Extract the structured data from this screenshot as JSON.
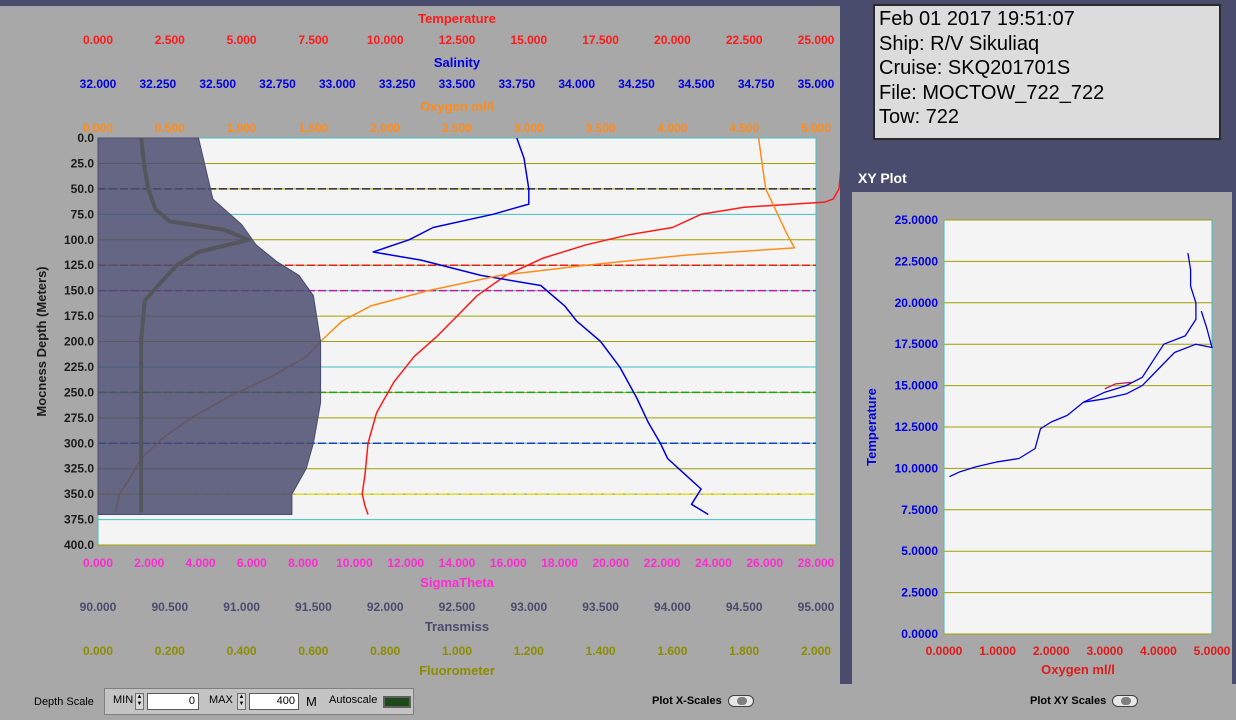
{
  "info": {
    "datetime": "Feb 01 2017 19:51:07",
    "ship": "Ship: R/V Sikuliaq",
    "cruise": "Cruise: SKQ201701S",
    "file": "File: MOCTOW_722_722",
    "tow": "Tow: 722"
  },
  "xy_panel_title": "XY Plot",
  "controls": {
    "depth_scale_label": "Depth Scale",
    "min_label": "MIN",
    "min_value": "0",
    "max_label": "MAX",
    "max_value": "400",
    "units": "M",
    "autoscale_label": "Autoscale",
    "plot_x_scales_label": "Plot X-Scales",
    "plot_xy_scales_label": "Plot XY Scales"
  },
  "colors": {
    "temperature": "#ff1a1a",
    "salinity": "#0000e0",
    "oxygen": "#ff8c1a",
    "sigma_theta": "#ff2ad4",
    "transmiss": "#4a4c6e",
    "fluorometer": "#8c8c00"
  },
  "chart_data": [
    {
      "type": "line",
      "ylabel": "Mocness Depth (Meters)",
      "ylim": [
        400,
        0
      ],
      "y_ticks": [
        "0.0",
        "25.0",
        "50.0",
        "75.0",
        "100.0",
        "125.0",
        "150.0",
        "175.0",
        "200.0",
        "225.0",
        "250.0",
        "275.0",
        "300.0",
        "325.0",
        "350.0",
        "375.0",
        "400.0"
      ],
      "grid": true,
      "top_axes": [
        {
          "label": "Temperature",
          "range": [
            0,
            25
          ],
          "ticks": [
            "0.000",
            "2.500",
            "5.000",
            "7.500",
            "10.000",
            "12.500",
            "15.000",
            "17.500",
            "20.000",
            "22.500",
            "25.000"
          ],
          "color": "#ff1a1a"
        },
        {
          "label": "Salinity",
          "range": [
            32,
            35
          ],
          "ticks": [
            "32.000",
            "32.250",
            "32.500",
            "32.750",
            "33.000",
            "33.250",
            "33.500",
            "33.750",
            "34.000",
            "34.250",
            "34.500",
            "34.750",
            "35.000"
          ],
          "color": "#0000e0"
        },
        {
          "label": "Oxygen ml/l",
          "range": [
            0,
            5
          ],
          "ticks": [
            "0.000",
            "0.500",
            "1.000",
            "1.500",
            "2.000",
            "2.500",
            "3.000",
            "3.500",
            "4.000",
            "4.500",
            "5.000"
          ],
          "color": "#ff8c1a"
        }
      ],
      "bottom_axes": [
        {
          "label": "SigmaTheta",
          "range": [
            0,
            28
          ],
          "ticks": [
            "0.000",
            "2.000",
            "4.000",
            "6.000",
            "8.000",
            "10.000",
            "12.000",
            "14.000",
            "16.000",
            "18.000",
            "20.000",
            "22.000",
            "24.000",
            "26.000",
            "28.000"
          ],
          "color": "#ff2ad4"
        },
        {
          "label": "Transmiss",
          "range": [
            90,
            95
          ],
          "ticks": [
            "90.000",
            "90.500",
            "91.000",
            "91.500",
            "92.000",
            "92.500",
            "93.000",
            "93.500",
            "94.000",
            "94.500",
            "95.000"
          ],
          "color": "#4a4c6e"
        },
        {
          "label": "Fluorometer",
          "range": [
            0,
            2
          ],
          "ticks": [
            "0.000",
            "0.200",
            "0.400",
            "0.600",
            "0.800",
            "1.000",
            "1.200",
            "1.400",
            "1.600",
            "1.800",
            "2.000"
          ],
          "color": "#8c8c00"
        }
      ],
      "horizontal_markers": [
        {
          "depth": 50,
          "color": "#2a2a2a"
        },
        {
          "depth": 125,
          "color": "#e02020"
        },
        {
          "depth": 150,
          "color": "#c020a0"
        },
        {
          "depth": 250,
          "color": "#20a020"
        },
        {
          "depth": 300,
          "color": "#2040c0"
        },
        {
          "depth": 350,
          "color": "#e0e020"
        }
      ],
      "series": [
        {
          "axis": "Temperature",
          "color": "#ff1a1a",
          "points": [
            [
              26.0,
              0
            ],
            [
              25.9,
              20
            ],
            [
              25.8,
              50
            ],
            [
              25.6,
              60
            ],
            [
              25.3,
              63
            ],
            [
              22.5,
              68
            ],
            [
              21.0,
              75
            ],
            [
              20.0,
              88
            ],
            [
              18.5,
              95
            ],
            [
              17.0,
              105
            ],
            [
              15.5,
              118
            ],
            [
              14.2,
              135
            ],
            [
              13.2,
              155
            ],
            [
              12.5,
              175
            ],
            [
              11.8,
              195
            ],
            [
              11.0,
              215
            ],
            [
              10.3,
              240
            ],
            [
              9.7,
              270
            ],
            [
              9.4,
              300
            ],
            [
              9.3,
              330
            ],
            [
              9.2,
              350
            ],
            [
              9.3,
              362
            ],
            [
              9.4,
              370
            ]
          ]
        },
        {
          "axis": "Salinity",
          "color": "#0000e0",
          "points": [
            [
              33.75,
              0
            ],
            [
              33.78,
              20
            ],
            [
              33.8,
              50
            ],
            [
              33.8,
              65
            ],
            [
              33.65,
              75
            ],
            [
              33.4,
              88
            ],
            [
              33.3,
              100
            ],
            [
              33.15,
              112
            ],
            [
              33.35,
              120
            ],
            [
              33.6,
              135
            ],
            [
              33.85,
              145
            ],
            [
              33.95,
              165
            ],
            [
              34.0,
              180
            ],
            [
              34.1,
              200
            ],
            [
              34.18,
              225
            ],
            [
              34.25,
              255
            ],
            [
              34.3,
              280
            ],
            [
              34.35,
              300
            ],
            [
              34.38,
              315
            ],
            [
              34.45,
              330
            ],
            [
              34.52,
              345
            ],
            [
              34.48,
              360
            ],
            [
              34.55,
              370
            ]
          ]
        },
        {
          "axis": "Oxygen ml/l",
          "color": "#ff8c1a",
          "points": [
            [
              4.6,
              0
            ],
            [
              4.62,
              20
            ],
            [
              4.65,
              50
            ],
            [
              4.7,
              65
            ],
            [
              4.75,
              80
            ],
            [
              4.8,
              95
            ],
            [
              4.85,
              108
            ],
            [
              4.1,
              115
            ],
            [
              3.4,
              125
            ],
            [
              2.8,
              135
            ],
            [
              2.3,
              150
            ],
            [
              1.9,
              165
            ],
            [
              1.7,
              180
            ],
            [
              1.55,
              200
            ],
            [
              1.45,
              215
            ],
            [
              1.2,
              235
            ],
            [
              0.9,
              255
            ],
            [
              0.65,
              275
            ],
            [
              0.45,
              295
            ],
            [
              0.3,
              315
            ],
            [
              0.22,
              335
            ],
            [
              0.15,
              350
            ],
            [
              0.12,
              368
            ]
          ]
        },
        {
          "axis": "Fluorometer",
          "color": "#8c8c00",
          "points": [
            [
              0.12,
              0
            ],
            [
              0.13,
              30
            ],
            [
              0.14,
              50
            ],
            [
              0.16,
              70
            ],
            [
              0.2,
              82
            ],
            [
              0.35,
              90
            ],
            [
              0.42,
              100
            ],
            [
              0.28,
              112
            ],
            [
              0.22,
              125
            ],
            [
              0.18,
              140
            ],
            [
              0.13,
              160
            ],
            [
              0.12,
              200
            ],
            [
              0.12,
              300
            ],
            [
              0.12,
              368
            ]
          ]
        },
        {
          "axis": "Transmiss",
          "color": "#4a4c6e",
          "points": [
            [
              90.7,
              0
            ],
            [
              90.75,
              30
            ],
            [
              90.8,
              60
            ],
            [
              91.0,
              85
            ],
            [
              91.1,
              105
            ],
            [
              91.25,
              122
            ],
            [
              91.4,
              135
            ],
            [
              91.5,
              155
            ],
            [
              91.55,
              200
            ],
            [
              91.55,
              260
            ],
            [
              91.5,
              300
            ],
            [
              91.45,
              325
            ],
            [
              91.35,
              350
            ],
            [
              91.35,
              370
            ]
          ]
        }
      ]
    },
    {
      "type": "line",
      "xlabel": "Oxygen ml/l",
      "ylabel": "Temperature",
      "xlim": [
        0,
        5
      ],
      "ylim": [
        0,
        25
      ],
      "x_ticks": [
        "0.0000",
        "1.0000",
        "2.0000",
        "3.0000",
        "4.0000",
        "5.0000"
      ],
      "y_ticks": [
        "0.0000",
        "2.5000",
        "5.0000",
        "7.5000",
        "10.0000",
        "12.5000",
        "15.0000",
        "17.5000",
        "20.0000",
        "22.5000",
        "25.0000"
      ],
      "grid": true,
      "series": [
        {
          "color": "#0000e0",
          "points": [
            [
              0.1,
              9.5
            ],
            [
              0.3,
              9.8
            ],
            [
              0.6,
              10.1
            ],
            [
              1.0,
              10.4
            ],
            [
              1.4,
              10.6
            ],
            [
              1.7,
              11.2
            ],
            [
              1.8,
              12.4
            ],
            [
              2.0,
              12.8
            ],
            [
              2.3,
              13.2
            ],
            [
              2.6,
              14.0
            ],
            [
              3.0,
              14.6
            ],
            [
              3.4,
              15.0
            ],
            [
              3.7,
              15.5
            ],
            [
              3.9,
              16.5
            ],
            [
              4.1,
              17.5
            ],
            [
              4.5,
              18.0
            ],
            [
              4.7,
              19.0
            ],
            [
              4.7,
              20.0
            ],
            [
              4.6,
              21.0
            ],
            [
              4.6,
              22.0
            ],
            [
              4.55,
              23.0
            ]
          ]
        },
        {
          "color": "#0000e0",
          "points": [
            [
              2.6,
              14.0
            ],
            [
              3.0,
              14.2
            ],
            [
              3.4,
              14.5
            ],
            [
              3.7,
              15.0
            ],
            [
              4.0,
              16.0
            ],
            [
              4.3,
              17.0
            ],
            [
              4.7,
              17.5
            ],
            [
              5.0,
              17.3
            ],
            [
              4.9,
              18.5
            ],
            [
              4.8,
              19.5
            ]
          ]
        },
        {
          "color": "#c02060",
          "points": [
            [
              3.0,
              14.8
            ],
            [
              3.2,
              15.1
            ],
            [
              3.5,
              15.2
            ]
          ]
        }
      ]
    }
  ]
}
